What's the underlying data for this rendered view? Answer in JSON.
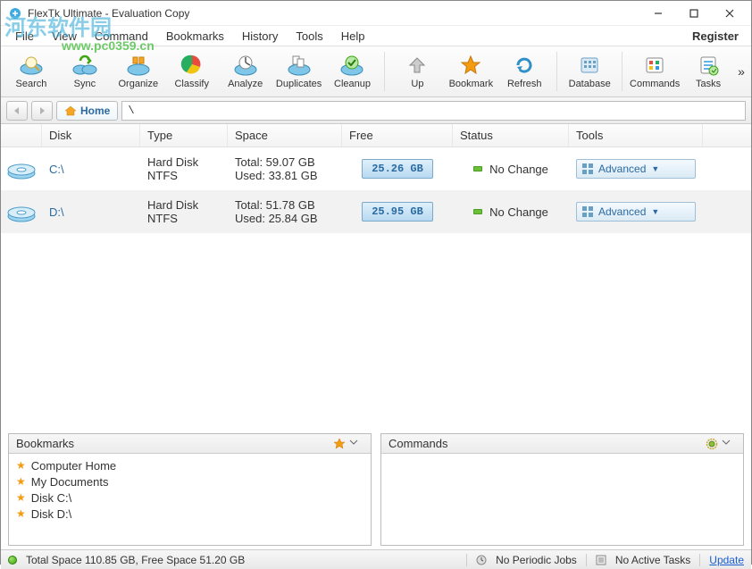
{
  "window": {
    "title": "FlexTk Ultimate - Evaluation Copy"
  },
  "watermark": {
    "text": "河东软件园",
    "url": "www.pc0359.cn"
  },
  "menu": {
    "file": "File",
    "view": "View",
    "command": "Command",
    "bookmarks": "Bookmarks",
    "history": "History",
    "tools": "Tools",
    "help": "Help",
    "register": "Register"
  },
  "toolbar": {
    "search": "Search",
    "sync": "Sync",
    "organize": "Organize",
    "classify": "Classify",
    "analyze": "Analyze",
    "duplicates": "Duplicates",
    "cleanup": "Cleanup",
    "up": "Up",
    "bookmark": "Bookmark",
    "refresh": "Refresh",
    "database": "Database",
    "commands": "Commands",
    "tasks": "Tasks"
  },
  "nav": {
    "home": "Home",
    "path": "\\"
  },
  "disk_table": {
    "headers": {
      "disk": "Disk",
      "type": "Type",
      "space": "Space",
      "free": "Free",
      "status": "Status",
      "tools": "Tools"
    },
    "rows": [
      {
        "name": "C:\\",
        "type": "Hard Disk",
        "fs": "NTFS",
        "total": "Total: 59.07 GB",
        "used": "Used: 33.81 GB",
        "free": "25.26 GB",
        "status": "No Change",
        "tools": "Advanced"
      },
      {
        "name": "D:\\",
        "type": "Hard Disk",
        "fs": "NTFS",
        "total": "Total: 51.78 GB",
        "used": "Used: 25.84 GB",
        "free": "25.95 GB",
        "status": "No Change",
        "tools": "Advanced"
      }
    ]
  },
  "bookmarks": {
    "title": "Bookmarks",
    "items": [
      "Computer Home",
      "My Documents",
      "Disk C:\\",
      "Disk D:\\"
    ]
  },
  "commands": {
    "title": "Commands"
  },
  "status": {
    "summary": "Total Space 110.85 GB, Free Space 51.20 GB",
    "periodic": "No Periodic Jobs",
    "tasks": "No Active Tasks",
    "update": "Update"
  }
}
